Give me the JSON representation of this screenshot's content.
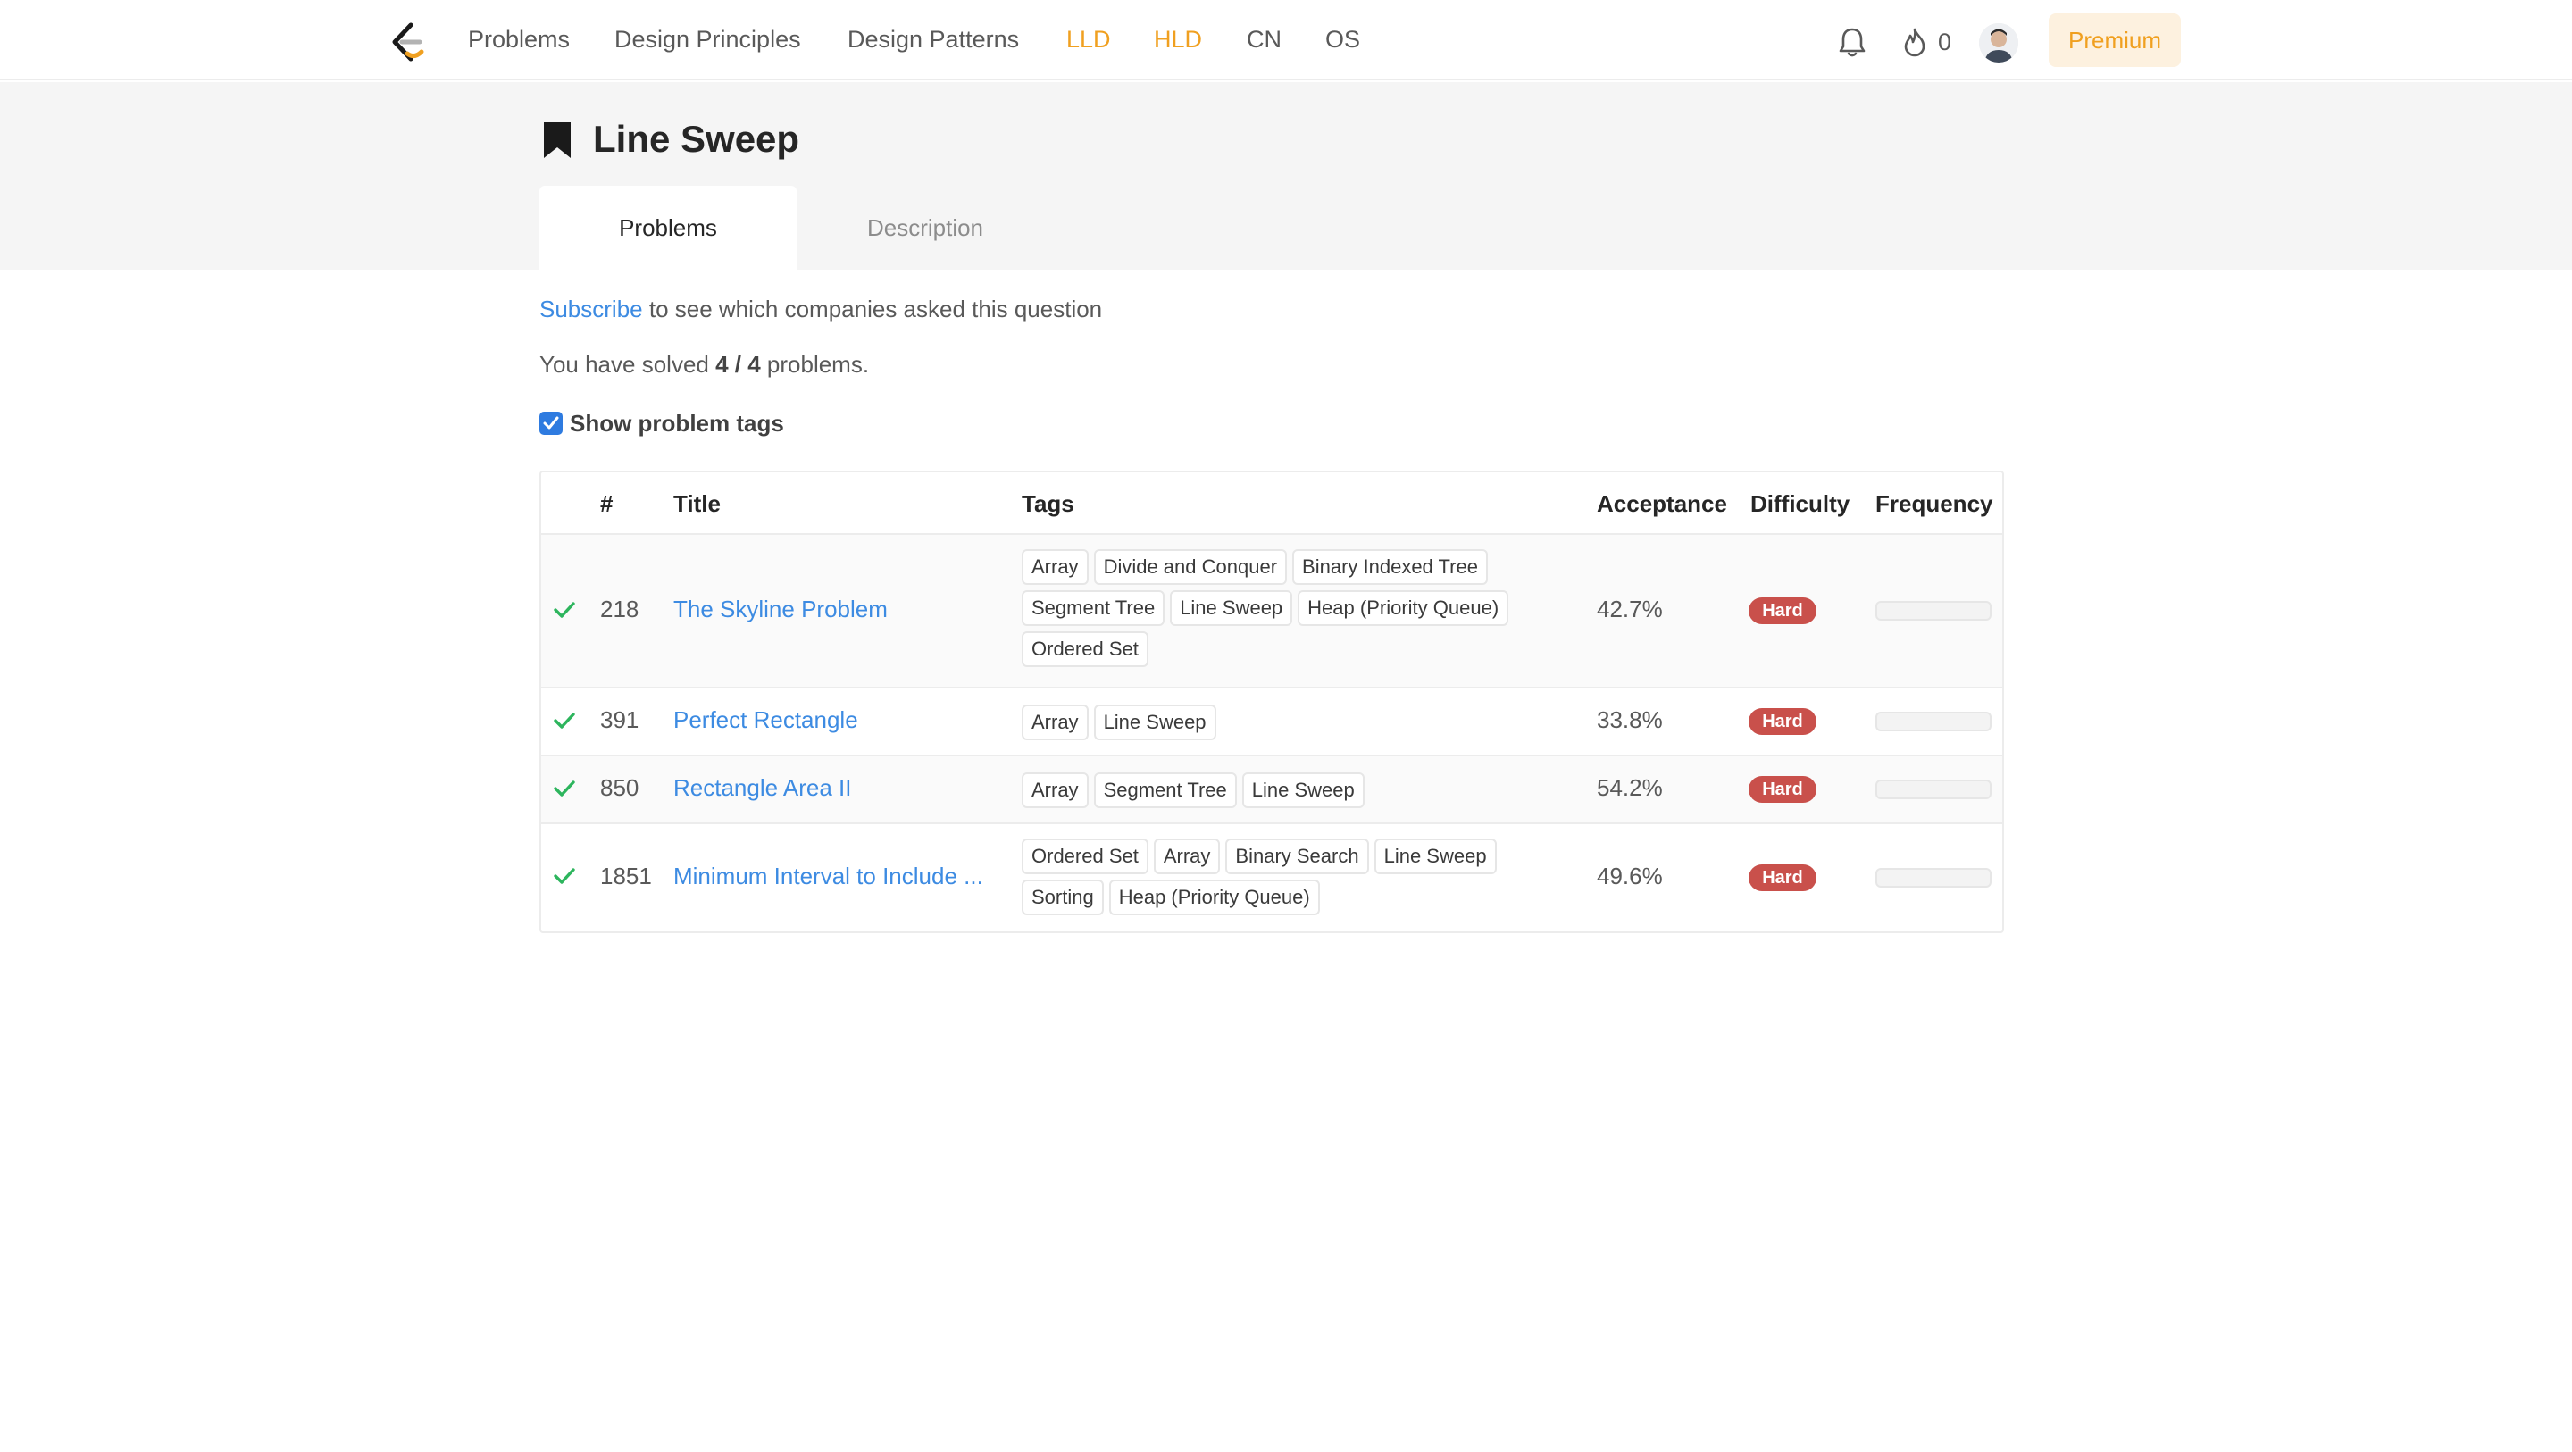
{
  "nav": {
    "links": [
      "Problems",
      "Design Principles",
      "Design Patterns",
      "LLD",
      "HLD",
      "CN",
      "OS"
    ],
    "streak_count": "0",
    "premium_label": "Premium",
    "accent_color": "#f0a020"
  },
  "header": {
    "title": "Line Sweep",
    "tabs": [
      "Problems",
      "Description"
    ],
    "active_tab": "Problems"
  },
  "info": {
    "subscribe_link": "Subscribe",
    "subscribe_text": " to see which companies asked this question",
    "solved_prefix": "You have solved ",
    "solved_value": "4 / 4",
    "solved_suffix": " problems.",
    "show_tags_label": "Show problem tags",
    "show_tags_checked": true
  },
  "table": {
    "headers": [
      "#",
      "Title",
      "Tags",
      "Acceptance",
      "Difficulty",
      "Frequency"
    ],
    "rows": [
      {
        "solved": true,
        "id": "218",
        "title": "The Skyline Problem",
        "tags": [
          "Array",
          "Divide and Conquer",
          "Binary Indexed Tree",
          "Segment Tree",
          "Line Sweep",
          "Heap (Priority Queue)",
          "Ordered Set"
        ],
        "acceptance": "42.7%",
        "difficulty": "Hard"
      },
      {
        "solved": true,
        "id": "391",
        "title": "Perfect Rectangle",
        "tags": [
          "Array",
          "Line Sweep"
        ],
        "acceptance": "33.8%",
        "difficulty": "Hard"
      },
      {
        "solved": true,
        "id": "850",
        "title": "Rectangle Area II",
        "tags": [
          "Array",
          "Segment Tree",
          "Line Sweep"
        ],
        "acceptance": "54.2%",
        "difficulty": "Hard"
      },
      {
        "solved": true,
        "id": "1851",
        "title": "Minimum Interval to Include ...",
        "tags": [
          "Ordered Set",
          "Array",
          "Binary Search",
          "Line Sweep",
          "Sorting",
          "Heap (Priority Queue)"
        ],
        "acceptance": "49.6%",
        "difficulty": "Hard"
      }
    ],
    "difficulty_color": "#c9504b",
    "check_color": "#2db55d",
    "link_color": "#3d8be2"
  }
}
